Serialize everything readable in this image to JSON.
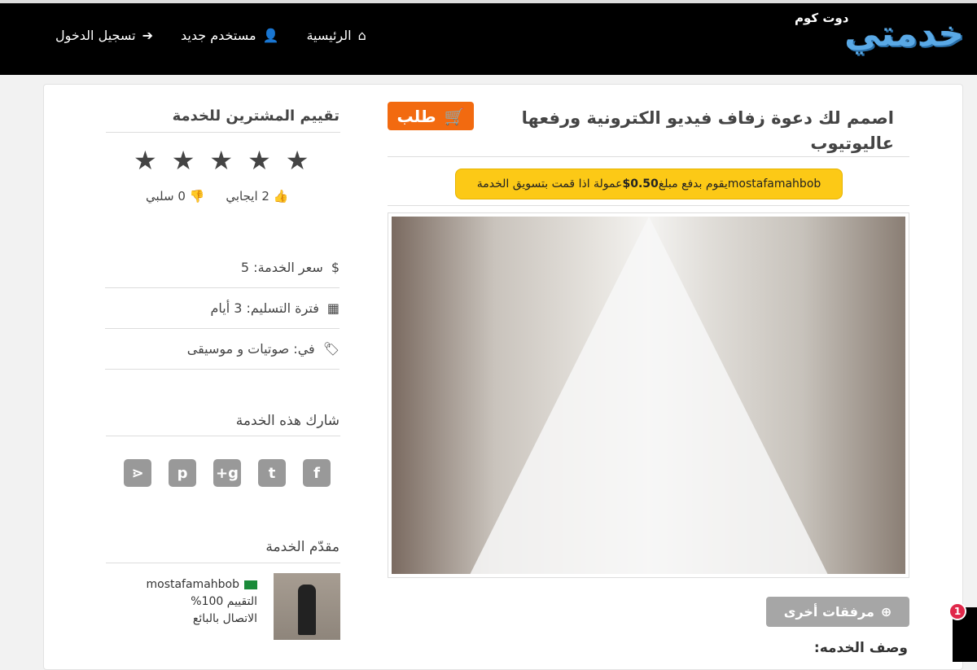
{
  "header": {
    "logo_text": "خدمتي",
    "logo_sub": "دوت كوم",
    "nav": [
      {
        "label": "الرئيسية",
        "icon": "home-icon"
      },
      {
        "label": "مستخدم جديد",
        "icon": "user-icon"
      },
      {
        "label": "تسجيل الدخول",
        "icon": "sign-in-icon"
      }
    ]
  },
  "service": {
    "title": "اصمم لك دعوة زفاف فيديو الكترونية ورفعها عاليوتيوب",
    "order_label": "طلب",
    "promo_user": "mostafamahbob",
    "promo_pre": " يقوم بدفع مبلغ ",
    "promo_amount": "$0.50",
    "promo_post": "عمولة اذا قمت بتسويق الخدمة",
    "attachments_label": "مرفقات أخرى",
    "description_label": "وصف الخدمه:"
  },
  "sidebar": {
    "rating_title": "تقييم المشترين للخدمة",
    "stars": 5,
    "positive": "2 ايجابي",
    "negative": "0 سلبي",
    "price": "سعر الخدمة: 5",
    "delivery": "فترة التسليم: 3 أيام",
    "category": "في: صوتيات و موسيقى",
    "share_title": "شارك هذه الخدمة",
    "social": [
      "f",
      "t",
      "g+",
      "p",
      "share"
    ],
    "provider_title": "مقدّم الخدمة",
    "seller_name": "mostafamahbob",
    "seller_rating": "التقييم 100%",
    "contact": "الاتصال بالبائع"
  },
  "notification_count": "1"
}
